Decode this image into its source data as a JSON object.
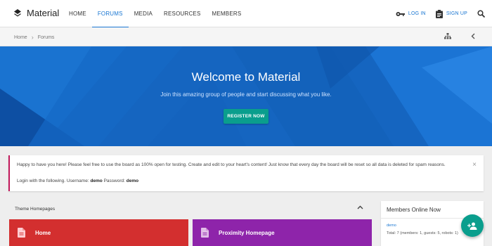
{
  "brand": {
    "name": "Material"
  },
  "nav": {
    "items": [
      {
        "label": "HOME",
        "active": false
      },
      {
        "label": "FORUMS",
        "active": true
      },
      {
        "label": "MEDIA",
        "active": false
      },
      {
        "label": "RESOURCES",
        "active": false
      },
      {
        "label": "MEMBERS",
        "active": false
      }
    ]
  },
  "auth": {
    "login_label": "LOG IN",
    "signup_label": "SIGN UP"
  },
  "breadcrumb": {
    "items": [
      "Home",
      "Forums"
    ]
  },
  "hero": {
    "title": "Welcome to Material",
    "subtitle": "Join this amazing group of people and start discussing what you like.",
    "register_label": "REGISTER NOW"
  },
  "notice": {
    "text": "Happy to have you here! Please feel free to use the board as 100% open for testing. Create and edit to your heart's content! Just know that every day the board will be reset so all data is deleted for spam reasons.",
    "login_prefix": "Login with the following. Username:",
    "username": "demo",
    "password_label": "Password:",
    "password": "demo",
    "close": "×"
  },
  "homepages": {
    "title": "Theme Homepages",
    "cards": [
      {
        "label": "Home",
        "color": "#d32f2f"
      },
      {
        "label": "Proximity Homepage",
        "color": "#8e24aa"
      }
    ]
  },
  "members_online": {
    "title": "Members Online Now",
    "user": "demo",
    "total": "Total: 7 (members: 1, guests: 5, robots: 1)"
  },
  "colors": {
    "accent": "#1976d2",
    "teal": "#0a9e8d",
    "hero": "#1565c0"
  },
  "icons": [
    "layers-icon",
    "key-icon",
    "clipboard-icon",
    "search-icon",
    "sitemap-icon",
    "chevron-left-icon",
    "chevron-right-icon",
    "close-icon",
    "chevron-up-icon",
    "document-icon",
    "add-person-icon"
  ]
}
